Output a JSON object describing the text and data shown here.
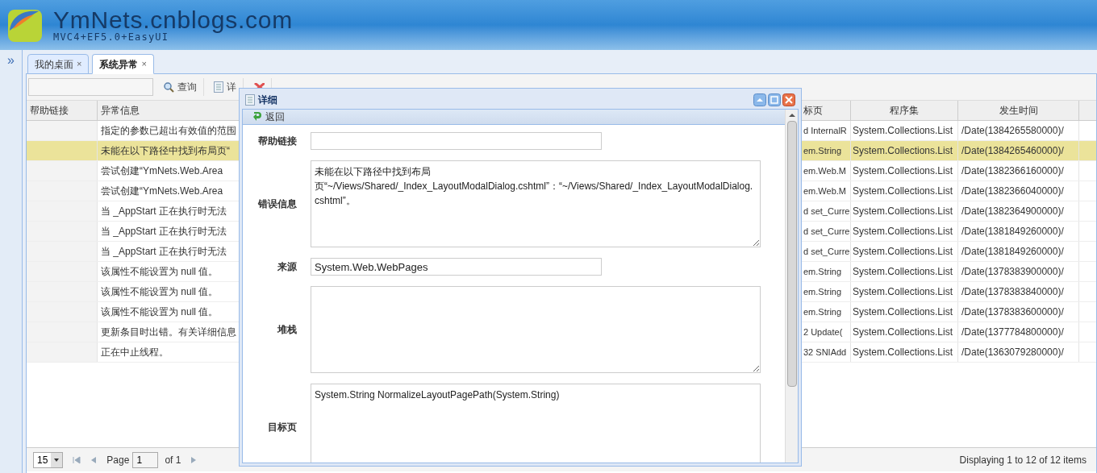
{
  "header": {
    "title": "YmNets.cnblogs.com",
    "subtitle": "MVC4+EF5.0+EasyUI"
  },
  "sidebar": {
    "toggle": "»"
  },
  "tabs": [
    {
      "label": "我的桌面",
      "close": "×",
      "selected": false
    },
    {
      "label": "系统异常",
      "close": "×",
      "selected": true
    }
  ],
  "toolbar": {
    "buttons": [
      {
        "label": "查询",
        "kind": "search"
      },
      {
        "label": "详",
        "kind": "detail"
      },
      {
        "kind": "delete"
      }
    ]
  },
  "table": {
    "columns": [
      "帮助链接",
      "异常信息",
      "标页",
      "程序集",
      "发生时间"
    ],
    "rows": [
      {
        "message": "指定的参数已超出有效值的范围",
        "target": "d InternalR",
        "assembly": "System.Collections.List",
        "time": "/Date(1384265580000)/",
        "selected": false
      },
      {
        "message": "未能在以下路径中找到布局页“",
        "target": "em.String",
        "assembly": "System.Collections.List",
        "time": "/Date(1384265460000)/",
        "selected": true
      },
      {
        "message": "尝试创建“YmNets.Web.Area",
        "target": "em.Web.M",
        "assembly": "System.Collections.List",
        "time": "/Date(1382366160000)/",
        "selected": false
      },
      {
        "message": "尝试创建“YmNets.Web.Area",
        "target": "em.Web.M",
        "assembly": "System.Collections.List",
        "time": "/Date(1382366040000)/",
        "selected": false
      },
      {
        "message": "当 _AppStart 正在执行时无法",
        "target": "d set_Curre",
        "assembly": "System.Collections.List",
        "time": "/Date(1382364900000)/",
        "selected": false
      },
      {
        "message": "当 _AppStart 正在执行时无法",
        "target": "d set_Curre",
        "assembly": "System.Collections.List",
        "time": "/Date(1381849260000)/",
        "selected": false
      },
      {
        "message": "当 _AppStart 正在执行时无法",
        "target": "d set_Curre",
        "assembly": "System.Collections.List",
        "time": "/Date(1381849260000)/",
        "selected": false
      },
      {
        "message": "该属性不能设置为 null 值。",
        "target": "em.String",
        "assembly": "System.Collections.List",
        "time": "/Date(1378383900000)/",
        "selected": false
      },
      {
        "message": "该属性不能设置为 null 值。",
        "target": "em.String",
        "assembly": "System.Collections.List",
        "time": "/Date(1378383840000)/",
        "selected": false
      },
      {
        "message": "该属性不能设置为 null 值。",
        "target": "em.String",
        "assembly": "System.Collections.List",
        "time": "/Date(1378383600000)/",
        "selected": false
      },
      {
        "message": "更新条目时出错。有关详细信息",
        "target": "2 Update(",
        "assembly": "System.Collections.List",
        "time": "/Date(1377784800000)/",
        "selected": false
      },
      {
        "message": "正在中止线程。",
        "target": "32 SNIAdd",
        "assembly": "System.Collections.List",
        "time": "/Date(1363079280000)/",
        "selected": false
      }
    ]
  },
  "pager": {
    "page_size": "15",
    "page_label": "Page",
    "page": "1",
    "of": "of 1",
    "summary": "Displaying 1 to 12 of 12 items"
  },
  "dialog": {
    "title": "详细",
    "back": "返回",
    "fields": [
      {
        "label": "帮助链接",
        "kind": "input"
      },
      {
        "label": "错误信息",
        "kind": "textarea",
        "value": "未能在以下路径中找到布局页“~/Views/Shared/_Index_LayoutModalDialog.cshtml”：“~/Views/Shared/_Index_LayoutModalDialog.cshtml”。"
      },
      {
        "label": "来源",
        "kind": "input",
        "value": "System.Web.WebPages"
      },
      {
        "label": "堆栈",
        "kind": "textarea"
      },
      {
        "label": "目标页",
        "kind": "textarea_cut",
        "value": "System.String NormalizeLayoutPagePath(System.String)"
      }
    ]
  }
}
